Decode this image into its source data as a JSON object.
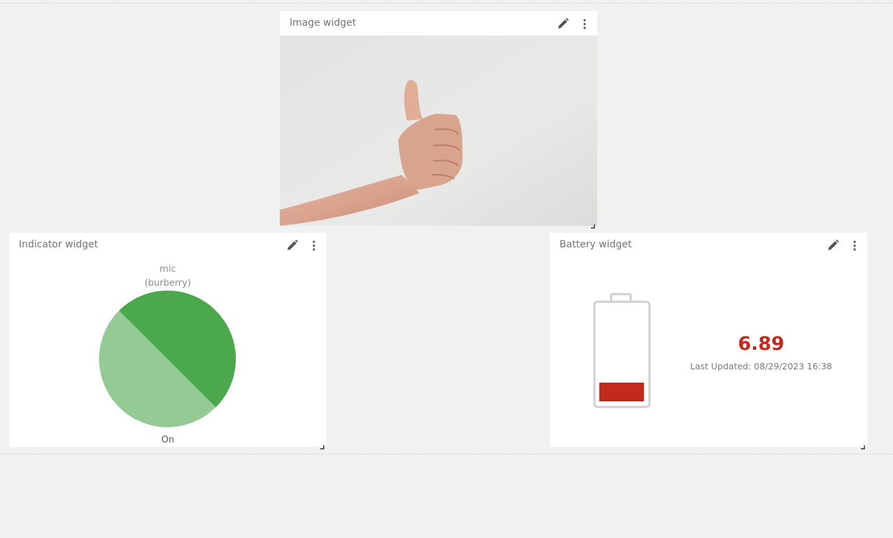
{
  "widgets": {
    "image": {
      "title": "Image widget",
      "image_icon": "thumbs-up-photo"
    },
    "indicator": {
      "title": "Indicator widget",
      "sensor_name": "mic",
      "device_name": "(burberry)",
      "state": "On",
      "colors": {
        "dark": "#4ba84c",
        "light": "#95ca95"
      }
    },
    "battery": {
      "title": "Battery widget",
      "value": "6.89",
      "last_updated": "Last Updated: 08/29/2023 16:38",
      "level_fraction": 0.2,
      "colors": {
        "level": "#c22a1d",
        "outline": "#cfcfcf"
      }
    }
  },
  "icons": {
    "edit": "pencil-icon",
    "menu": "vertical-ellipsis-icon",
    "resize": "resize-corner-icon"
  }
}
